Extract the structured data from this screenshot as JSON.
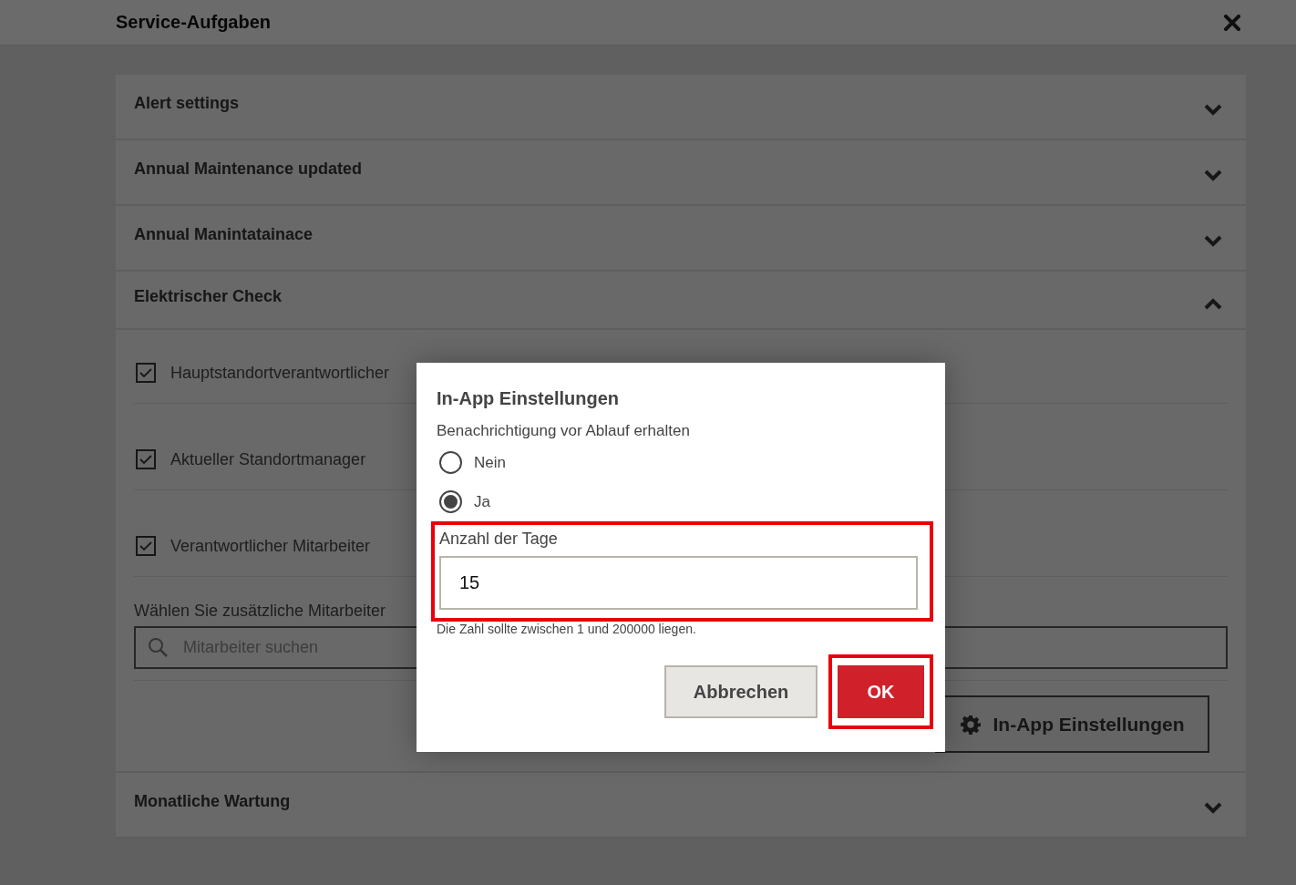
{
  "page": {
    "title": "Service-Aufgaben"
  },
  "sections": [
    {
      "title": "Alert settings",
      "expanded": false
    },
    {
      "title": "Annual Maintenance updated",
      "expanded": false
    },
    {
      "title": "Annual Manintatainace",
      "expanded": false
    },
    {
      "title": "Elektrischer Check",
      "expanded": true,
      "recipients": [
        {
          "label": "Hauptstandortverantwortlicher",
          "checked": true
        },
        {
          "label": "Aktueller Standortmanager",
          "checked": true
        },
        {
          "label": "Verantwortlicher Mitarbeiter",
          "checked": true
        }
      ],
      "additional_label": "Wählen Sie zusätzliche Mitarbeiter",
      "search": {
        "placeholder": "Mitarbeiter suchen"
      },
      "settings_button": "In-App Einstellungen"
    },
    {
      "title": "Monatliche Wartung",
      "expanded": false
    }
  ],
  "dialog": {
    "title": "In-App Einstellungen",
    "question": "Benachrichtigung vor Ablauf erhalten",
    "options": [
      {
        "label": "Nein",
        "selected": false
      },
      {
        "label": "Ja",
        "selected": true
      }
    ],
    "days_field": {
      "label": "Anzahl der Tage",
      "value": "15",
      "highlighted": true
    },
    "hint": "Die Zahl sollte zwischen 1 und 200000 liegen.",
    "buttons": [
      {
        "label": "Abbrechen",
        "kind": "secondary",
        "highlighted": false
      },
      {
        "label": "OK",
        "kind": "primary",
        "highlighted": true
      }
    ]
  }
}
